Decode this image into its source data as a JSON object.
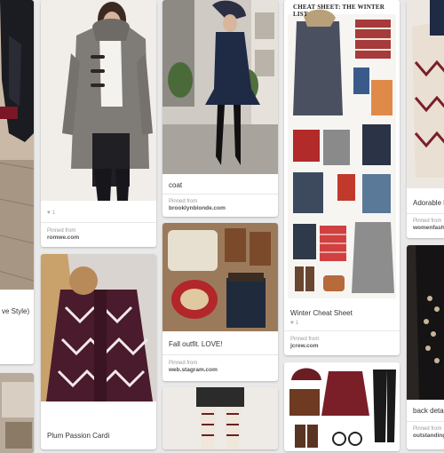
{
  "pins": [
    {
      "id": "leather-jacket",
      "description": "ve Style)",
      "has_source": false
    },
    {
      "id": "duffle-coat",
      "description": "",
      "likes": "1",
      "pinned_from_label": "Pinned from",
      "source": "romwe.com"
    },
    {
      "id": "coat",
      "description": "coat",
      "pinned_from_label": "Pinned from",
      "source": "brooklynblonde.com"
    },
    {
      "id": "winter-cheat-sheet",
      "header_text": "CHEAT SHEET: THE WINTER LIST",
      "description": "Winter Cheat Sheet",
      "likes": "1",
      "pinned_from_label": "Pinned from",
      "source": "jcrew.com"
    },
    {
      "id": "adorable-cardigan",
      "description": "Adorable k",
      "pinned_from_label": "Pinned from",
      "source": "womenfashio"
    },
    {
      "id": "plum-passion-cardi",
      "description": "Plum Passion Cardi"
    },
    {
      "id": "fall-outfit",
      "description": "Fall outfit. LOVE!",
      "pinned_from_label": "Pinned from",
      "source": "web.stagram.com"
    },
    {
      "id": "back-detail",
      "description": "back detail",
      "pinned_from_label": "Pinned from",
      "source": "outstanding"
    }
  ],
  "colors": {
    "background": "#e9e9e9",
    "card": "#ffffff",
    "burgundy": "#5a2032",
    "navy": "#1f2a44"
  }
}
